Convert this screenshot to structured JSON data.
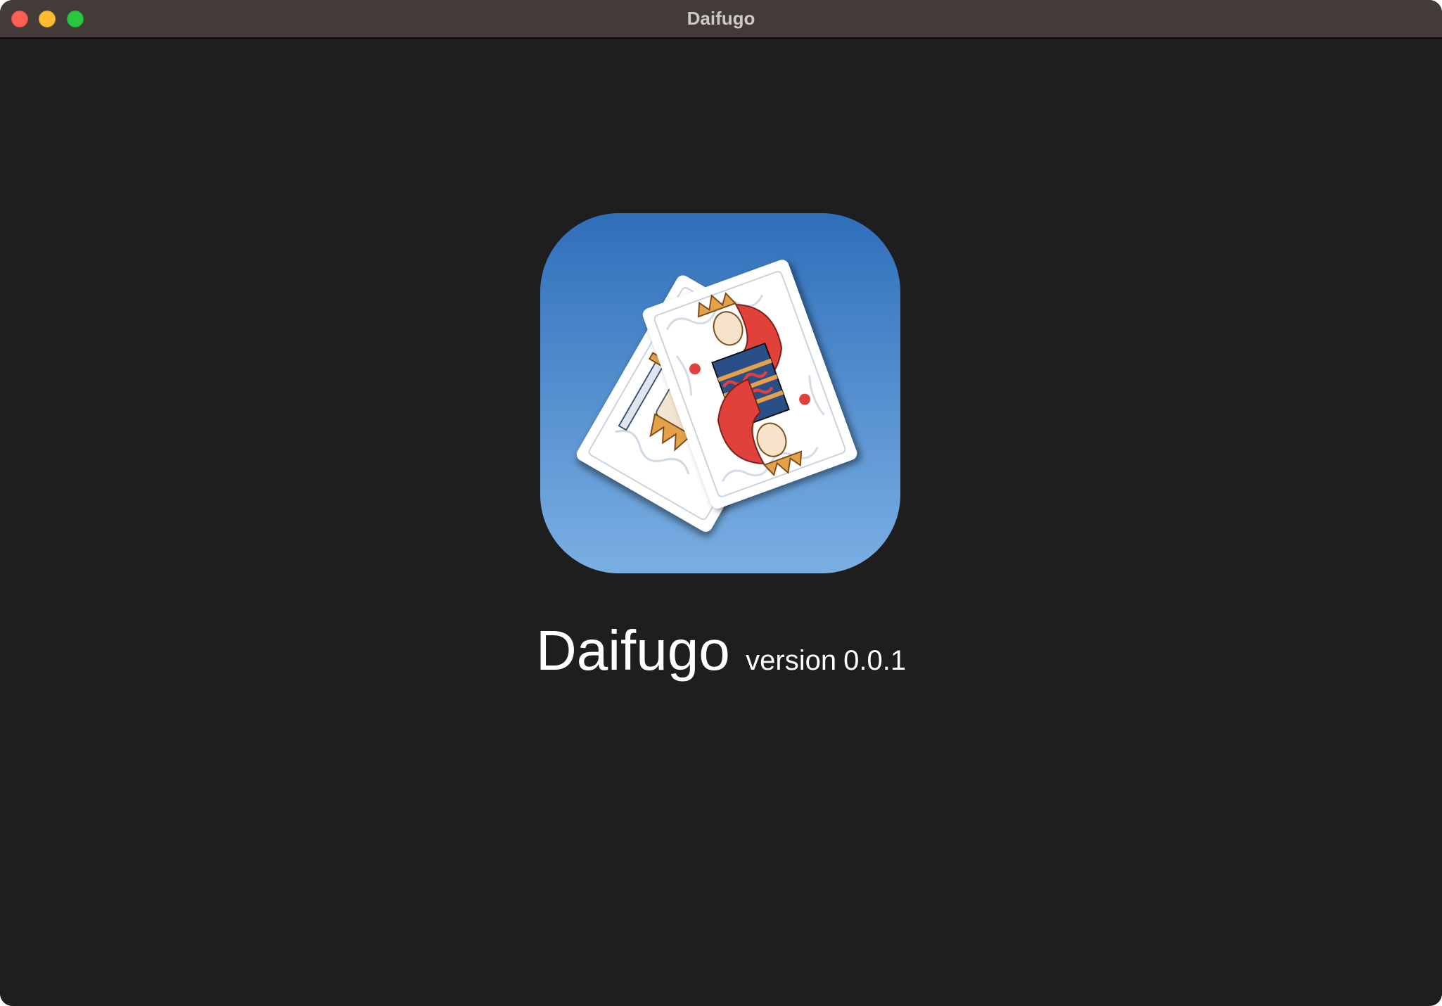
{
  "window": {
    "title": "Daifugo",
    "controls": [
      "close",
      "minimize",
      "zoom"
    ]
  },
  "about": {
    "icon": "playing-cards-app-icon",
    "app_name": "Daifugo",
    "version_label": "version",
    "version_number": "0.0.1"
  },
  "colors": {
    "background": "#1e1e1e",
    "titlebar": "#433b38",
    "icon_blue_top": "#2f6fba",
    "icon_blue_bottom": "#79aee3",
    "card_red": "#e0433a",
    "card_gold": "#e3a24a"
  }
}
